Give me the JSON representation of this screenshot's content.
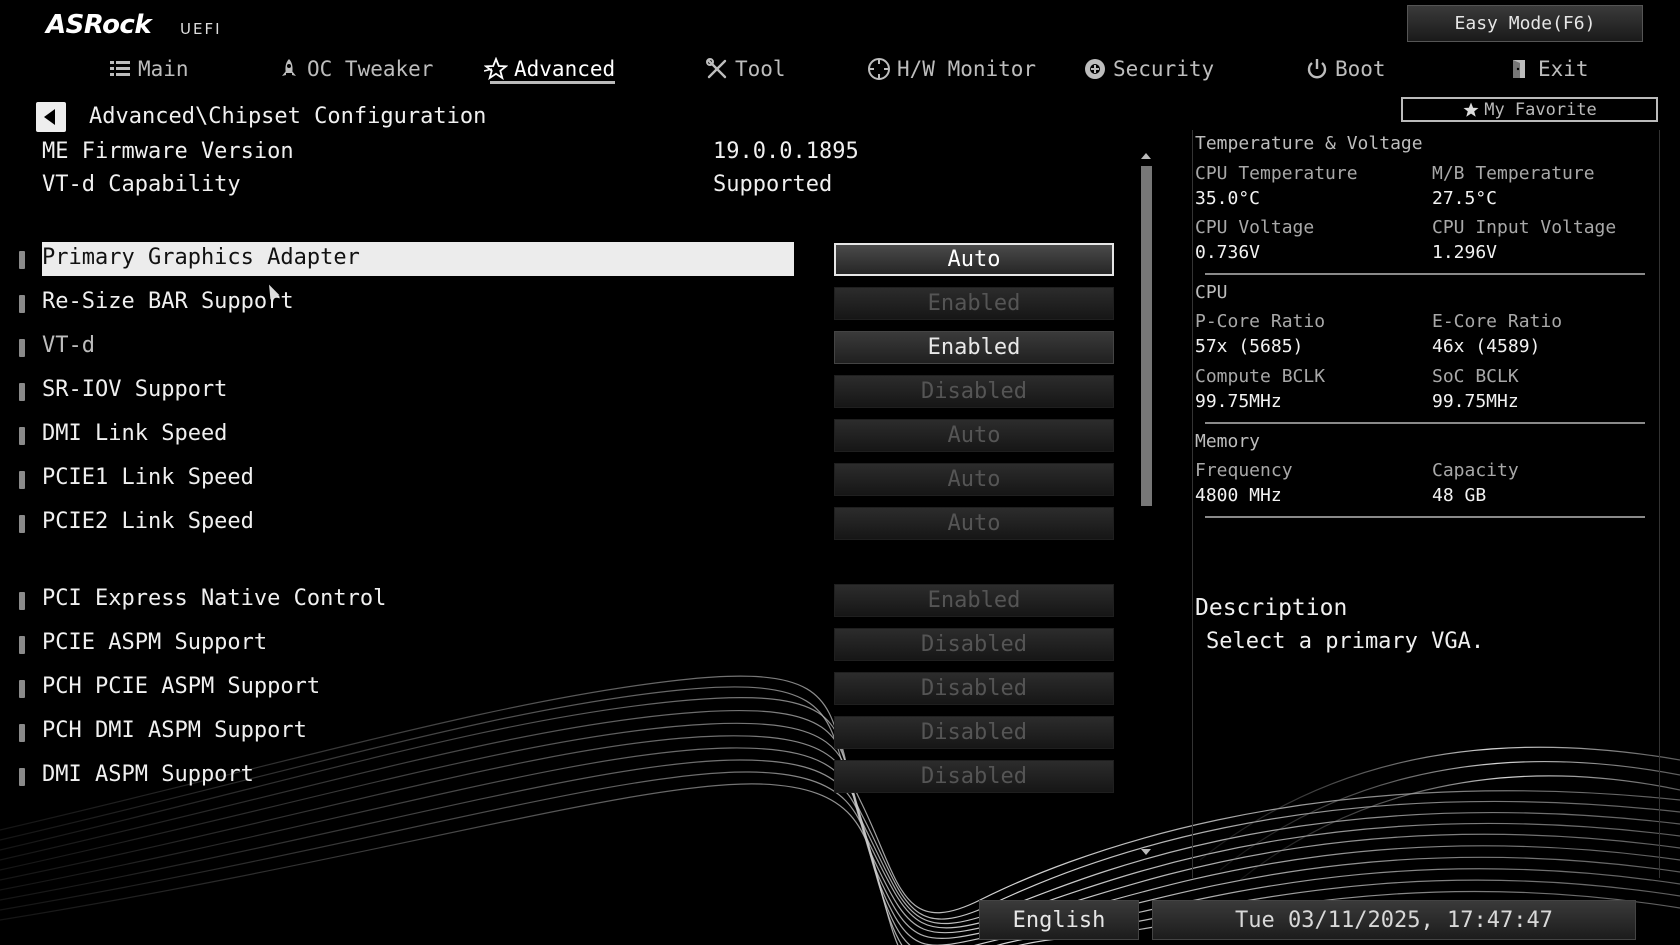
{
  "brand": {
    "logo": "ASRock",
    "sub": "UEFI"
  },
  "easy_mode": "Easy Mode(F6)",
  "nav": [
    {
      "label": "Main",
      "icon": "list-icon"
    },
    {
      "label": "OC Tweaker",
      "icon": "rocket-icon"
    },
    {
      "label": "Advanced",
      "icon": "star-icon",
      "active": true
    },
    {
      "label": "Tool",
      "icon": "tools-icon"
    },
    {
      "label": "H/W Monitor",
      "icon": "monitor-icon"
    },
    {
      "label": "Security",
      "icon": "shield-icon"
    },
    {
      "label": "Boot",
      "icon": "power-icon"
    },
    {
      "label": "Exit",
      "icon": "exit-icon"
    }
  ],
  "favorite": "My Favorite",
  "breadcrumb": "Advanced\\Chipset Configuration",
  "info": [
    {
      "label": "ME Firmware Version",
      "value": "19.0.0.1895"
    },
    {
      "label": "VT-d Capability",
      "value": "Supported"
    }
  ],
  "settings": [
    {
      "label": "Primary Graphics Adapter",
      "value": "Auto",
      "selected": true,
      "enabled": true
    },
    {
      "label": "Re-Size BAR Support",
      "value": "Enabled",
      "enabled": false
    },
    {
      "label": "VT-d",
      "value": "Enabled",
      "enabled": true,
      "dim_label": true
    },
    {
      "label": "SR-IOV Support",
      "value": "Disabled",
      "enabled": false
    },
    {
      "label": "DMI Link Speed",
      "value": "Auto",
      "enabled": false
    },
    {
      "label": "PCIE1 Link Speed",
      "value": "Auto",
      "enabled": false
    },
    {
      "label": "PCIE2 Link Speed",
      "value": "Auto",
      "enabled": false
    },
    {
      "label": "PCI Express Native Control",
      "value": "Enabled",
      "enabled": false
    },
    {
      "label": "PCIE ASPM Support",
      "value": "Disabled",
      "enabled": false
    },
    {
      "label": "PCH PCIE ASPM Support",
      "value": "Disabled",
      "enabled": false
    },
    {
      "label": "PCH DMI ASPM Support",
      "value": "Disabled",
      "enabled": false
    },
    {
      "label": "DMI ASPM Support",
      "value": "Disabled",
      "enabled": false
    }
  ],
  "monitor": {
    "temp_voltage_title": "Temperature & Voltage",
    "cpu_temp_label": "CPU Temperature",
    "cpu_temp": "35.0°C",
    "mb_temp_label": "M/B Temperature",
    "mb_temp": "27.5°C",
    "cpu_voltage_label": "CPU Voltage",
    "cpu_voltage": "0.736V",
    "cpu_input_voltage_label": "CPU Input Voltage",
    "cpu_input_voltage": "1.296V",
    "cpu_title": "CPU",
    "pcore_label": "P-Core Ratio",
    "pcore": "57x (5685)",
    "ecore_label": "E-Core Ratio",
    "ecore": "46x (4589)",
    "bclk_label": "Compute BCLK",
    "bclk": "99.75MHz",
    "soc_label": "SoC BCLK",
    "soc": "99.75MHz",
    "memory_title": "Memory",
    "freq_label": "Frequency",
    "freq": "4800 MHz",
    "cap_label": "Capacity",
    "cap": "48 GB"
  },
  "description": {
    "title": "Description",
    "text": "Select a primary VGA."
  },
  "footer": {
    "language": "English",
    "datetime": "Tue 03/11/2025, 17:47:47"
  }
}
